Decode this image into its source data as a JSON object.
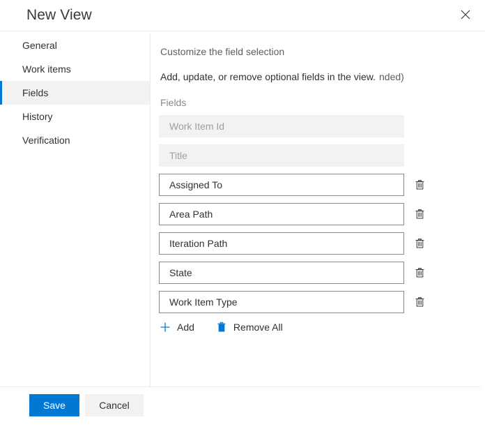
{
  "dialog": {
    "title": "New View",
    "close_icon": "close-icon"
  },
  "sidebar": {
    "items": [
      {
        "label": "General",
        "selected": false
      },
      {
        "label": "Work items",
        "selected": false
      },
      {
        "label": "Fields",
        "selected": true
      },
      {
        "label": "History",
        "selected": false
      },
      {
        "label": "Verification",
        "selected": false
      }
    ]
  },
  "content": {
    "section_title": "Customize the field selection",
    "description": "Add, update, or remove optional fields in the view.",
    "description_tail": "nded)",
    "fields_label": "Fields",
    "fields": [
      {
        "value": "Work Item Id",
        "disabled": true,
        "deletable": false
      },
      {
        "value": "Title",
        "disabled": true,
        "deletable": false
      },
      {
        "value": "Assigned To",
        "disabled": false,
        "deletable": true
      },
      {
        "value": "Area Path",
        "disabled": false,
        "deletable": true
      },
      {
        "value": "Iteration Path",
        "disabled": false,
        "deletable": true
      },
      {
        "value": "State",
        "disabled": false,
        "deletable": true
      },
      {
        "value": "Work Item Type",
        "disabled": false,
        "deletable": true
      }
    ],
    "commands": {
      "add_label": "Add",
      "add_icon": "plus-icon",
      "remove_all_label": "Remove All",
      "remove_all_icon": "trash-icon"
    },
    "delete_icon": "trash-icon"
  },
  "footer": {
    "save_label": "Save",
    "cancel_label": "Cancel"
  },
  "colors": {
    "accent": "#0078d4",
    "selected_nav_background": "#f3f2f1",
    "disabled_field_background": "#f3f2f1",
    "border": "#8a8886",
    "divider": "#ebebeb"
  }
}
